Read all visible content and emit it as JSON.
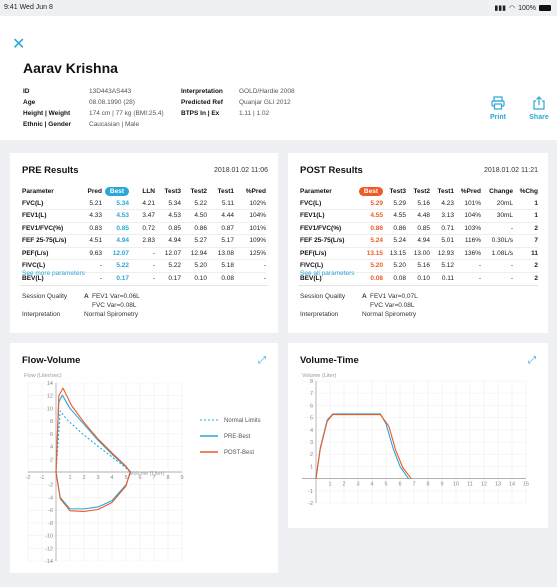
{
  "status_bar": {
    "time_date": "9:41  Wed Jun 8",
    "battery": "100%"
  },
  "patient": {
    "name": "Aarav Krishna",
    "fields_left": [
      {
        "label": "ID",
        "value": "13D443AS443"
      },
      {
        "label": "Age",
        "value": "08.08.1990 (28)"
      },
      {
        "label": "Height | Weight",
        "value": "174 cm | 77 kg  (BMI:25.4)"
      },
      {
        "label": "Ethnic | Gender",
        "value": "Caucasian | Male"
      }
    ],
    "fields_right": [
      {
        "label": "Interpretation",
        "value": "GOLD/Hardie 2008"
      },
      {
        "label": "Predicted Ref",
        "value": "Quanjar GLI 2012"
      },
      {
        "label": "BTPS In | Ex",
        "value": "1.11 | 1.02"
      }
    ]
  },
  "actions": {
    "print": "Print",
    "share": "Share"
  },
  "colors": {
    "accent": "#2aa7d8",
    "post": "#ef5a24",
    "bg": "#eef0f3"
  },
  "pre": {
    "title": "PRE Results",
    "date": "2018.01.02 11:06",
    "headers": [
      "Parameter",
      "Pred",
      "Best",
      "LLN",
      "Test3",
      "Test2",
      "Test1",
      "%Pred"
    ],
    "rows": [
      [
        "FVC(L)",
        "5.21",
        "5.34",
        "4.21",
        "5.34",
        "5.22",
        "5.11",
        "102%"
      ],
      [
        "FEV1(L)",
        "4.33",
        "4.53",
        "3.47",
        "4.53",
        "4.50",
        "4.44",
        "104%"
      ],
      [
        "FEV1/FVC(%)",
        "0.83",
        "0.85",
        "0.72",
        "0.85",
        "0.86",
        "0.87",
        "101%"
      ],
      [
        "FEF 25-75(L/s)",
        "4.51",
        "4.94",
        "2.83",
        "4.94",
        "5.27",
        "5.17",
        "109%"
      ],
      [
        "PEF(L/s)",
        "9.63",
        "12.07",
        "-",
        "12.07",
        "12.94",
        "13.08",
        "125%"
      ],
      [
        "FIVC(L)",
        "-",
        "5.22",
        "-",
        "5.22",
        "5.20",
        "5.18",
        "-"
      ],
      [
        "BEV(L)",
        "-",
        "0.17",
        "-",
        "0.17",
        "0.10",
        "0.08",
        "-"
      ]
    ],
    "more": "See more parameters",
    "session_label": "Session Quality",
    "session_grade": "A",
    "session_l1": "FEV1 Var=0.06L",
    "session_l2": "FVC Var=0.08L",
    "interp_label": "Interpretation",
    "interp_value": "Normal Spirometry"
  },
  "post": {
    "title": "POST Results",
    "date": "2018.01.02 11:21",
    "headers": [
      "Parameter",
      "Best",
      "Test3",
      "Test2",
      "Test1",
      "%Pred",
      "Change",
      "%Chg"
    ],
    "rows": [
      [
        "FVC(L)",
        "5.29",
        "5.29",
        "5.16",
        "4.23",
        "101%",
        "20mL",
        "1"
      ],
      [
        "FEV1(L)",
        "4.55",
        "4.55",
        "4.48",
        "3.13",
        "104%",
        "30mL",
        "1"
      ],
      [
        "FEV1/FVC(%)",
        "0.86",
        "0.86",
        "0.85",
        "0.71",
        "103%",
        "-",
        "2"
      ],
      [
        "FEF 25-75(L/s)",
        "5.24",
        "5.24",
        "4.94",
        "5.01",
        "116%",
        "0.30L/s",
        "7"
      ],
      [
        "PEF(L/s)",
        "13.15",
        "13.15",
        "13.00",
        "12.93",
        "136%",
        "1.08L/s",
        "11"
      ],
      [
        "FIVC(L)",
        "5.20",
        "5.20",
        "5.16",
        "5.12",
        "-",
        "-",
        "2"
      ],
      [
        "BEV(L)",
        "0.08",
        "0.08",
        "0.10",
        "0.11",
        "-",
        "-",
        "2"
      ]
    ],
    "more": "See all parameters",
    "session_label": "Session Quality",
    "session_grade": "A",
    "session_l1": "FEV1 Var=0.07L",
    "session_l2": "FVC Var=0.08L",
    "interp_label": "Interpretation",
    "interp_value": "Normal Spirometry"
  },
  "flow_volume": {
    "title": "Flow-Volume",
    "y_axis_title": "Flow (Liter/sec)",
    "x_axis_title": "Volume (Liter)",
    "legend": [
      "Normal Limits",
      "PRE-Best",
      "POST-Best"
    ]
  },
  "volume_time": {
    "title": "Volume-Time",
    "y_axis_title": "Volume (Liter)"
  },
  "chart_data": [
    {
      "type": "line",
      "title": "Flow-Volume",
      "xlabel": "Volume (Liter)",
      "ylabel": "Flow (Liter/sec)",
      "xlim": [
        -2,
        9
      ],
      "ylim": [
        -14,
        14
      ],
      "x_ticks": [
        -2,
        -1,
        1,
        2,
        3,
        4,
        5,
        6,
        7,
        8,
        9
      ],
      "y_ticks": [
        14,
        12,
        10,
        8,
        6,
        4,
        2,
        -2,
        -4,
        -6,
        -8,
        -10,
        -12,
        -14
      ],
      "series": [
        {
          "name": "Normal Limits",
          "x": [
            0,
            0.3,
            0.8,
            2,
            3.5,
            4.8,
            5.3
          ],
          "y": [
            0,
            9.6,
            8.2,
            5.8,
            3.2,
            1,
            0
          ]
        },
        {
          "name": "PRE-Best",
          "x": [
            0,
            0.2,
            0.45,
            1,
            2,
            3,
            4,
            5,
            5.34,
            5,
            4,
            3,
            2,
            1,
            0.3,
            0
          ],
          "y": [
            0,
            11,
            12.1,
            10,
            7.5,
            5,
            2.8,
            0.8,
            0,
            -2,
            -4.5,
            -5.5,
            -5.8,
            -5.8,
            -4,
            0
          ]
        },
        {
          "name": "POST-Best",
          "x": [
            0,
            0.2,
            0.5,
            1.1,
            2,
            3,
            4,
            5,
            5.29,
            5,
            4,
            3,
            2,
            1,
            0.3,
            0
          ],
          "y": [
            0,
            12,
            13.2,
            10.5,
            7.8,
            5.2,
            3,
            0.9,
            0,
            -2.2,
            -4.8,
            -5.9,
            -6.2,
            -6.1,
            -4.2,
            0
          ]
        }
      ]
    },
    {
      "type": "line",
      "title": "Volume-Time",
      "ylabel": "Volume (Liter)",
      "xlim": [
        -1,
        15
      ],
      "ylim": [
        -2,
        8
      ],
      "x_ticks": [
        1,
        2,
        3,
        4,
        5,
        6,
        7,
        8,
        9,
        10,
        11,
        12,
        13,
        14,
        15
      ],
      "y_ticks": [
        8,
        7,
        6,
        5,
        4,
        3,
        2,
        1,
        -1,
        -2
      ],
      "series": [
        {
          "name": "PRE",
          "x": [
            0,
            0.3,
            0.8,
            1.2,
            2,
            4,
            4.6,
            5,
            5.5,
            6,
            6.6
          ],
          "y": [
            0,
            2.5,
            4.8,
            5.3,
            5.3,
            5.3,
            5.3,
            4.5,
            2.5,
            1,
            0
          ]
        },
        {
          "name": "POST",
          "x": [
            0,
            0.3,
            0.8,
            1.2,
            2,
            4,
            4.6,
            5.2,
            5.7,
            6.2,
            6.8
          ],
          "y": [
            0,
            2.4,
            4.7,
            5.25,
            5.25,
            5.25,
            5.25,
            4.3,
            2.3,
            0.9,
            0
          ]
        }
      ]
    }
  ]
}
